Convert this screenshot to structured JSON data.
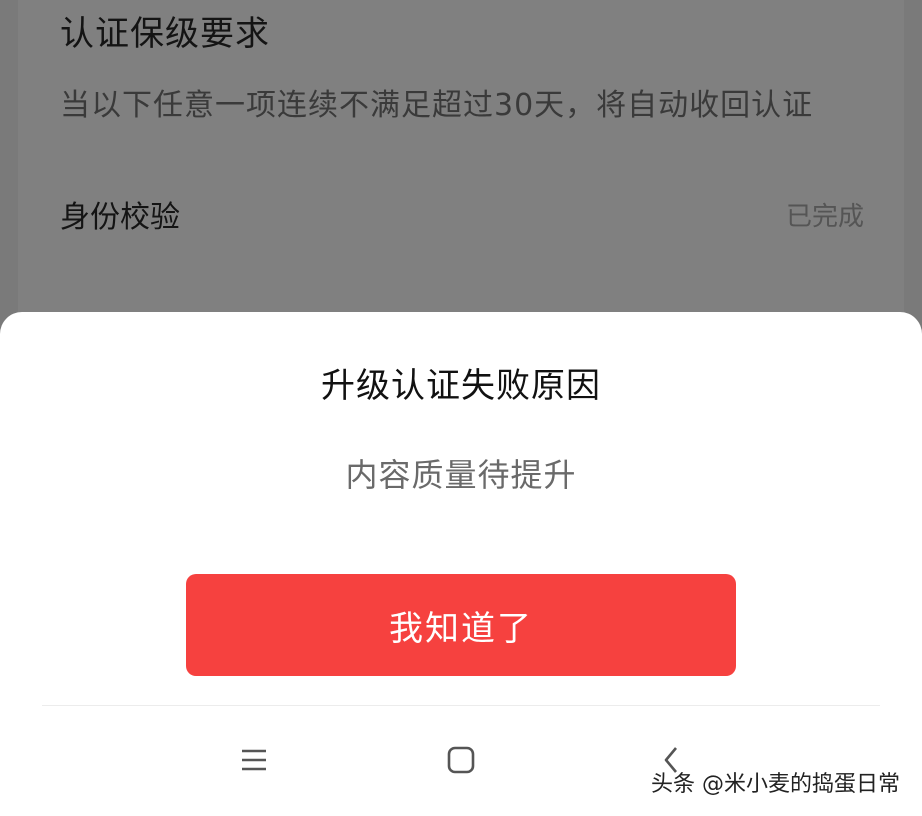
{
  "background": {
    "section_title": "认证保级要求",
    "description": "当以下任意一项连续不满足超过30天，将自动收回认证",
    "rows": [
      {
        "label": "身份校验",
        "status": "已完成"
      }
    ]
  },
  "dialog": {
    "title": "升级认证失败原因",
    "message": "内容质量待提升",
    "confirm_label": "我知道了"
  },
  "navbar": {
    "menu_icon": "menu-icon",
    "home_icon": "home-icon",
    "back_icon": "back-icon"
  },
  "watermark": "头条 @米小麦的捣蛋日常",
  "colors": {
    "accent": "#f6413f",
    "overlay": "#7a7a7a",
    "sheet": "#ffffff"
  }
}
